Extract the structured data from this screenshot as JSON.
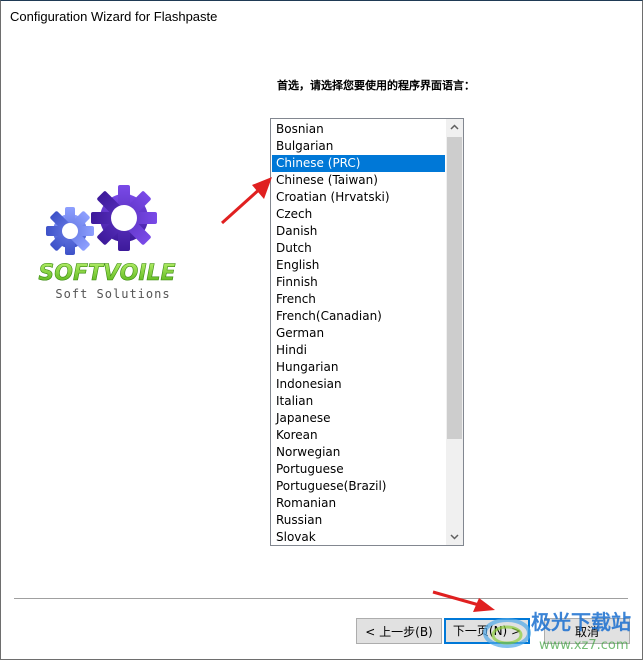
{
  "window": {
    "title": "Configuration Wizard for Flashpaste"
  },
  "prompt": "首选，请选择您要使用的程序界面语言：",
  "logo": {
    "brand": "SOFTVOILE",
    "tagline": "Soft Solutions",
    "colors": {
      "gear_small": "#5a6fe0",
      "gear_large": "#5b2bc4",
      "brand_text": "#7ccf2a",
      "tagline_text": "#555555"
    }
  },
  "language_list": {
    "selected": "Chinese (PRC)",
    "items": [
      "Bosnian",
      "Bulgarian",
      "Chinese (PRC)",
      "Chinese (Taiwan)",
      "Croatian (Hrvatski)",
      "Czech",
      "Danish",
      "Dutch",
      "English",
      "Finnish",
      "French",
      "French(Canadian)",
      "German",
      "Hindi",
      "Hungarian",
      "Indonesian",
      "Italian",
      "Japanese",
      "Korean",
      "Norwegian",
      "Portuguese",
      "Portuguese(Brazil)",
      "Romanian",
      "Russian",
      "Slovak"
    ],
    "scroll_up_icon": "chevron-up",
    "scroll_down_icon": "chevron-down",
    "selection_color": "#0078d7"
  },
  "buttons": {
    "back": "< 上一步(B)",
    "next": "下一页(N) >",
    "cancel": "取消"
  },
  "annotations": {
    "arrow_color": "#e02020"
  },
  "watermark": {
    "text": "极光下载站",
    "url_text": "www.xz7.com"
  }
}
